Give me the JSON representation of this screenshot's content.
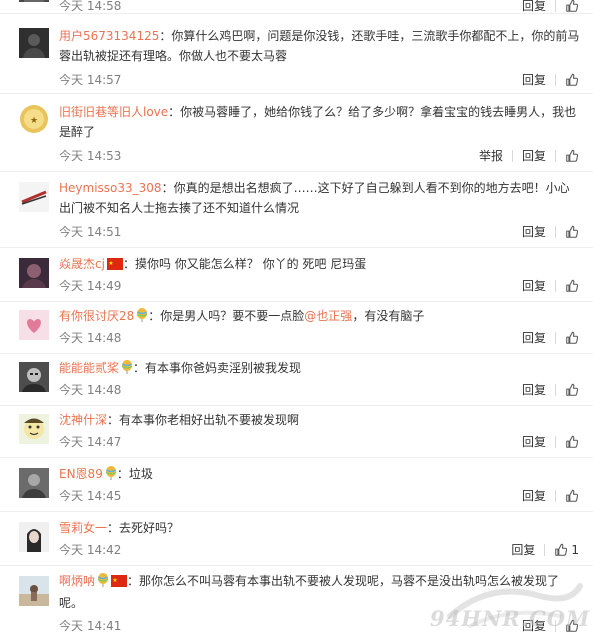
{
  "actions": {
    "reply": "回复",
    "report": "举报"
  },
  "comments": [
    {
      "user": "",
      "text": "",
      "time": "今天 14:58",
      "likes": "",
      "report": false
    },
    {
      "user": "用户5673134125",
      "text": "：你算什么鸡巴啊，问题是你没钱，还歌手哇，三流歌手你都配不上，你的前马蓉出轨被捉还有理咯。你做人也不要太马蓉",
      "time": "今天 14:57",
      "likes": "",
      "report": false
    },
    {
      "user": "旧街旧巷等旧人love",
      "text": "：你被马蓉睡了，她给你钱了么？给了多少啊？拿着宝宝的钱去睡男人，我也是醉了",
      "time": "今天 14:53",
      "likes": "",
      "report": true
    },
    {
      "user": "Heymisso33_308",
      "text": "：你真的是想出名想疯了……这下好了自己躲到人看不到你的地方去吧！小心出门被不知名人士拖去揍了还不知道什么情况",
      "time": "今天 14:51",
      "likes": "",
      "report": false
    },
    {
      "user": "焱晟杰cj",
      "badge": "flag-cn",
      "text": "：摸你吗 你又能怎么样？ 你丫的 死吧 尼玛蛋",
      "time": "今天 14:49",
      "likes": "",
      "report": false
    },
    {
      "user": "有你很讨厌28",
      "badge": "balloon",
      "text": "：你是男人吗？要不要一点脸",
      "mention": "@也正强",
      "text_after": "，有没有脑子",
      "time": "今天 14:48",
      "likes": "",
      "report": false
    },
    {
      "user": "能能能贰桨",
      "badge": "balloon",
      "text": "：有本事你爸妈卖淫别被我发现",
      "time": "今天 14:48",
      "likes": "",
      "report": false
    },
    {
      "user": "沈神什深",
      "text": "：有本事你老相好出轨不要被发现啊",
      "time": "今天 14:47",
      "likes": "",
      "report": false
    },
    {
      "user": "EN恩89",
      "badge": "balloon",
      "text": "：垃圾",
      "time": "今天 14:45",
      "likes": "",
      "report": false
    },
    {
      "user": "雪莉女一",
      "text": "：去死好吗？",
      "time": "今天 14:42",
      "likes": "1",
      "report": false
    },
    {
      "user": "啊炳呐",
      "badge": "balloon-flag",
      "text": "：那你怎么不叫马蓉有本事出轨不要被人发现呢，马蓉不是没出轨吗怎么被发现了呢。",
      "time": "今天 14:41",
      "likes": "",
      "report": false
    }
  ],
  "watermark": {
    "text": "94HNR.COM"
  },
  "colors": {
    "username": "#eb7350",
    "time": "#808080",
    "divider": "#eeeeee"
  }
}
